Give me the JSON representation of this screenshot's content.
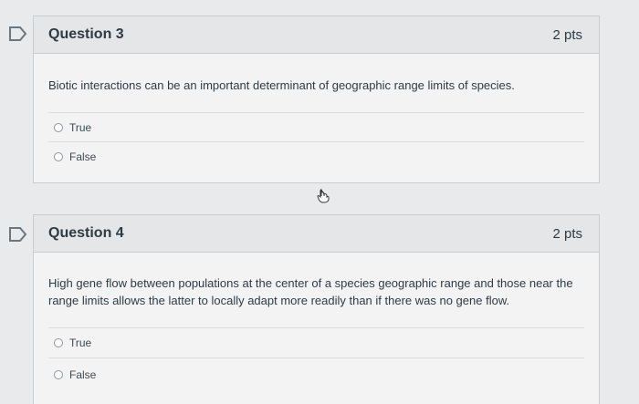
{
  "questions": [
    {
      "title": "Question 3",
      "points": "2 pts",
      "text": "Biotic interactions can be an important determinant of geographic range limits of species.",
      "answers": [
        "True",
        "False"
      ]
    },
    {
      "title": "Question 4",
      "points": "2 pts",
      "text": "High gene flow between populations at the center of a species geographic range and those near the range limits allows the latter to locally adapt more readily than if there was no gene flow.",
      "answers": [
        "True",
        "False"
      ]
    }
  ],
  "colors": {
    "flag": "#6b7780",
    "border": "#c7cdd1",
    "header_bg": "#e4e6e8"
  },
  "icons": {
    "flag": "flag-question-icon",
    "cursor": "hand-pointer-icon"
  }
}
